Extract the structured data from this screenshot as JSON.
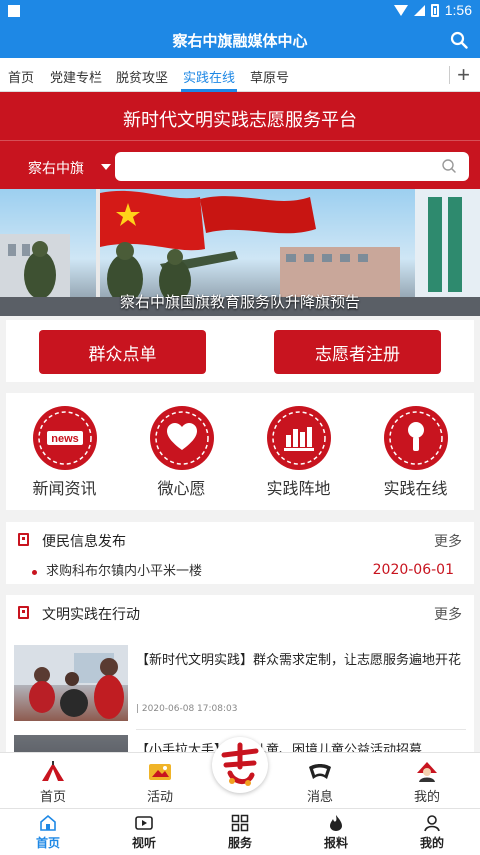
{
  "status_bar": {
    "time": "1:56"
  },
  "header": {
    "title": "察右中旗融媒体中心"
  },
  "tabs": [
    {
      "label": "首页"
    },
    {
      "label": "党建专栏"
    },
    {
      "label": "脱贫攻坚"
    },
    {
      "label": "实践在线",
      "active": true
    },
    {
      "label": "草原号"
    }
  ],
  "platform": {
    "title": "新时代文明实践志愿服务平台",
    "region": "察右中旗",
    "search_value": "",
    "search_placeholder": ""
  },
  "banner": {
    "caption": "察右中旗国旗教育服务队升降旗预告"
  },
  "actions": {
    "order_label": "群众点单",
    "register_label": "志愿者注册"
  },
  "services": [
    {
      "label": "新闻资讯",
      "icon": "news-icon"
    },
    {
      "label": "微心愿",
      "icon": "heart-icon"
    },
    {
      "label": "实践阵地",
      "icon": "base-icon"
    },
    {
      "label": "实践在线",
      "icon": "microphone-icon"
    }
  ],
  "notice": {
    "title": "便民信息发布",
    "more": "更多",
    "item_text": "求购科布尔镇内小平米一楼",
    "item_date": "2020-06-01"
  },
  "action_news": {
    "title": "文明实践在行动",
    "more": "更多",
    "items": [
      {
        "title": "【新时代文明实践】群众需求定制，让志愿服务遍地开花",
        "meta": "| 2020-06-08 17:08:03"
      },
      {
        "title": "【小手拉大手】留守儿童、困境儿童公益活动招募"
      }
    ]
  },
  "bottom_nav_primary": [
    {
      "label": "首页",
      "icon": "home-tent-icon"
    },
    {
      "label": "活动",
      "icon": "activity-icon"
    },
    {
      "label": "消息",
      "icon": "message-icon"
    },
    {
      "label": "我的",
      "icon": "profile-icon"
    }
  ],
  "bottom_nav_secondary": [
    {
      "label": "首页",
      "icon": "home-icon",
      "active": true
    },
    {
      "label": "视听",
      "icon": "video-icon"
    },
    {
      "label": "服务",
      "icon": "grid-icon"
    },
    {
      "label": "报料",
      "icon": "fire-icon"
    },
    {
      "label": "我的",
      "icon": "person-icon"
    }
  ],
  "colors": {
    "brand_blue": "#1e88e5",
    "brand_red": "#c8141f"
  }
}
